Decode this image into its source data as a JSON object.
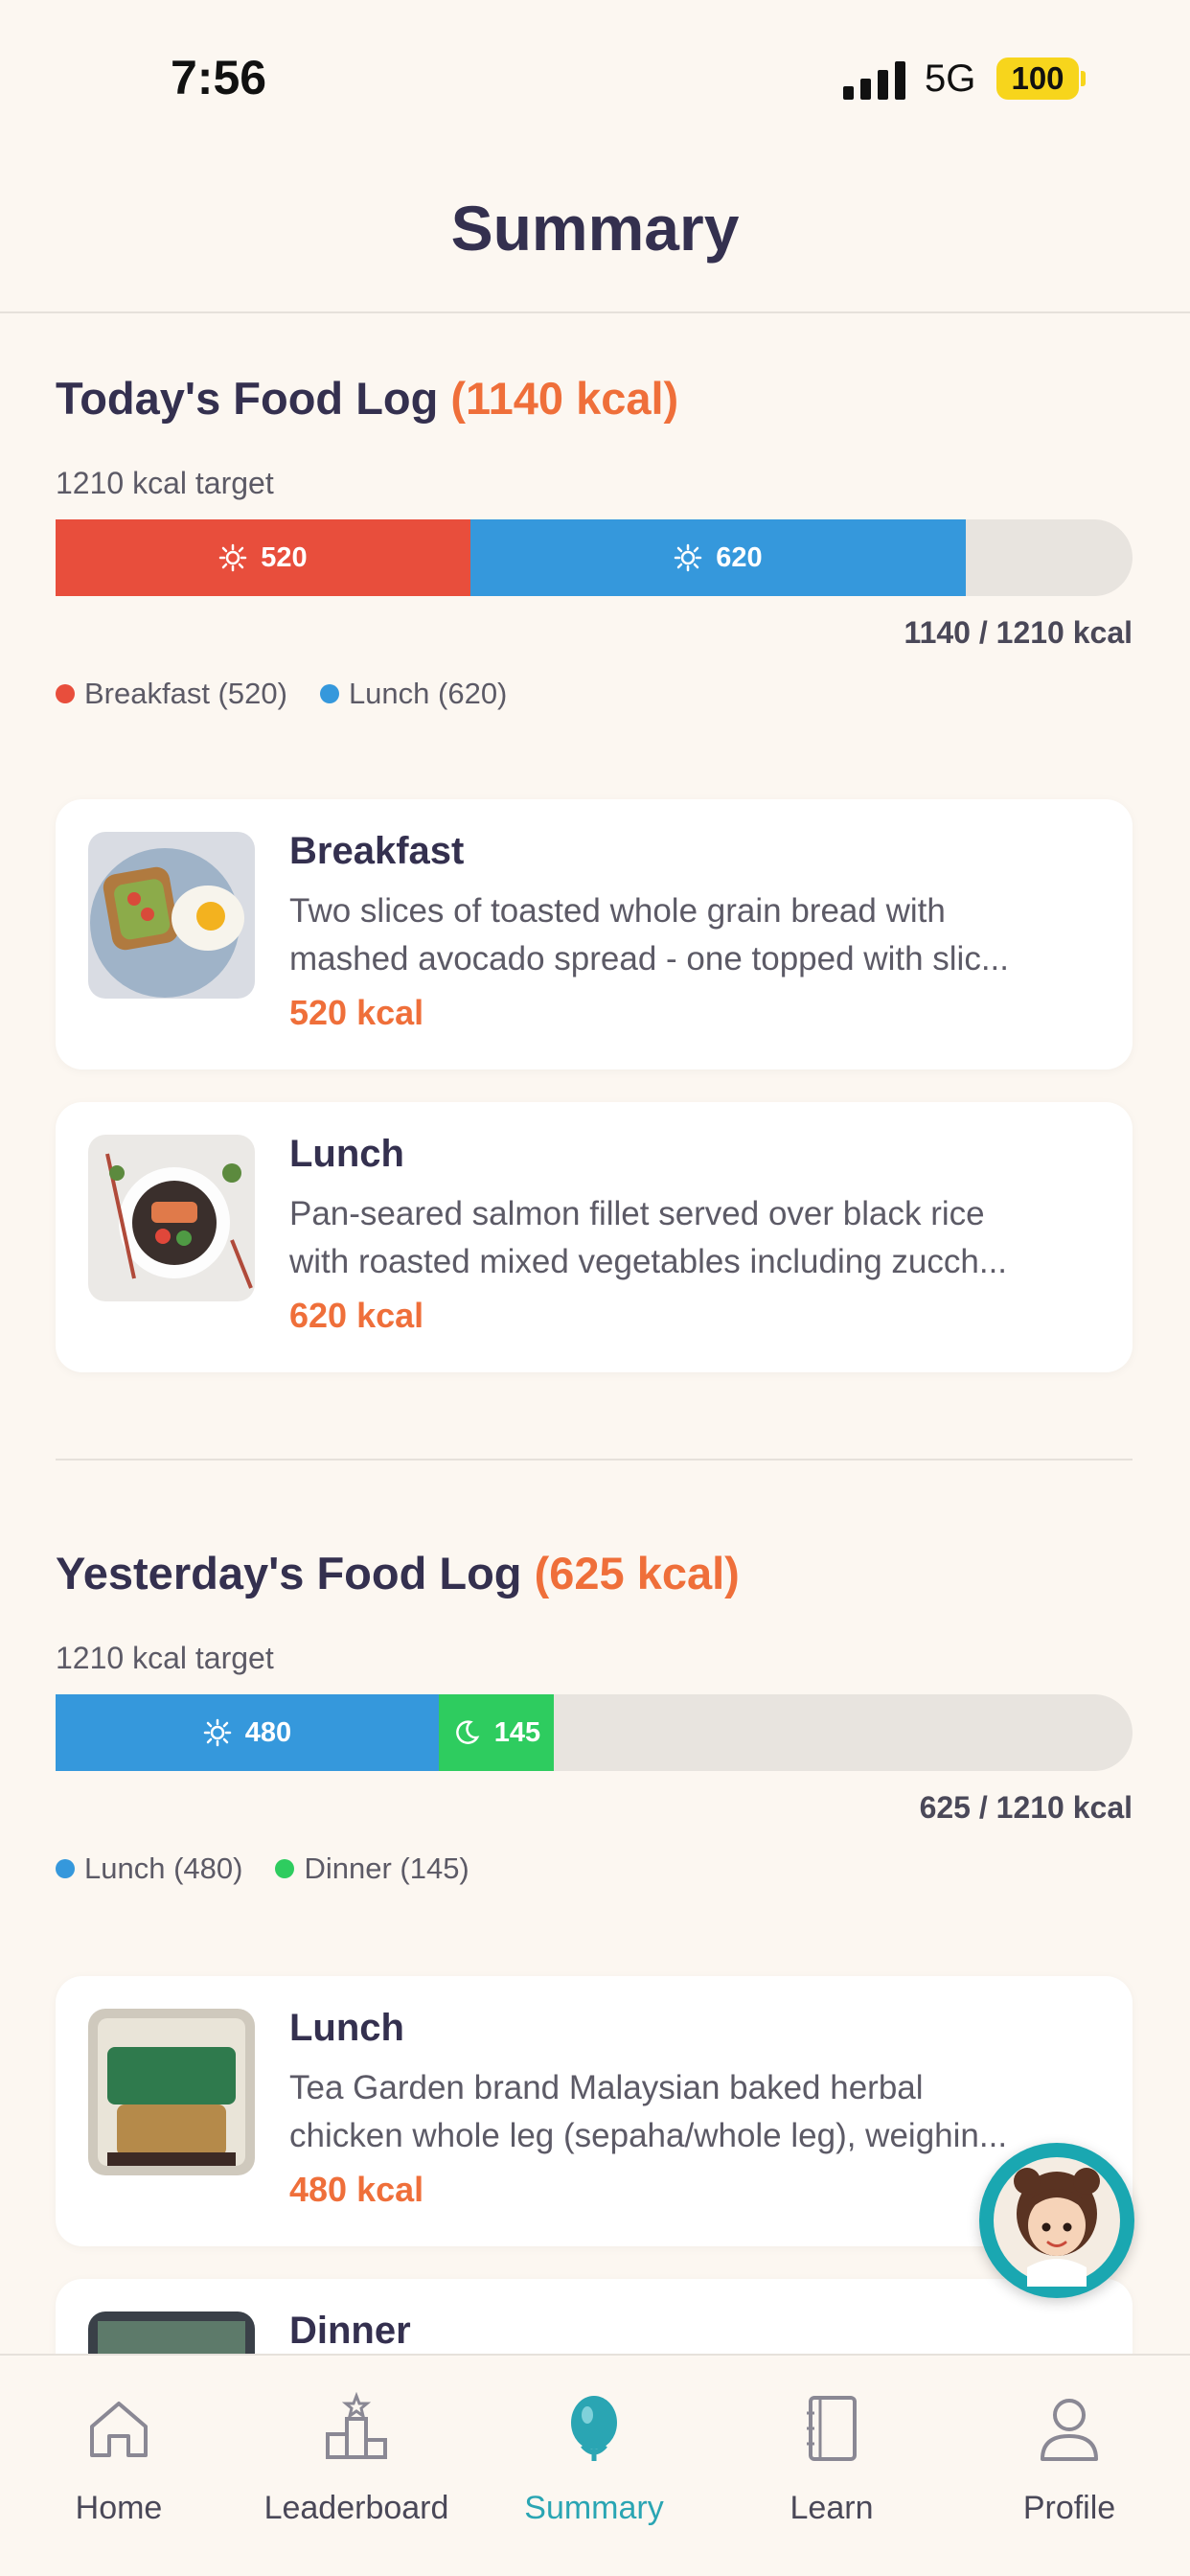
{
  "status": {
    "time": "7:56",
    "network": "5G",
    "battery": "100"
  },
  "header": {
    "title": "Summary"
  },
  "today": {
    "title": "Today's Food Log",
    "total_label": "(1140 kcal)",
    "target_label": "1210 kcal target",
    "progress": {
      "consumed": 1140,
      "target": 1210
    },
    "segments": [
      {
        "meal": "Breakfast",
        "value": "520",
        "kcal": 520,
        "color": "#e84e3c",
        "icon": "sunrise-icon"
      },
      {
        "meal": "Lunch",
        "value": "620",
        "kcal": 620,
        "color": "#3598dc",
        "icon": "sun-icon"
      }
    ],
    "total_text": "1140 / 1210 kcal",
    "legend": [
      {
        "label": "Breakfast (520)",
        "color": "#e84e3c"
      },
      {
        "label": "Lunch (620)",
        "color": "#3598dc"
      }
    ],
    "meals": [
      {
        "name": "Breakfast",
        "desc_line1": "Two slices of toasted whole grain bread with",
        "desc_line2": "mashed avocado spread - one topped with slic...",
        "kcal": "520 kcal"
      },
      {
        "name": "Lunch",
        "desc_line1": "Pan-seared salmon fillet served over black rice",
        "desc_line2": "with roasted mixed vegetables including zucch...",
        "kcal": "620 kcal"
      }
    ]
  },
  "yesterday": {
    "title": "Yesterday's Food Log",
    "total_label": "(625 kcal)",
    "target_label": "1210 kcal target",
    "progress": {
      "consumed": 625,
      "target": 1210
    },
    "segments": [
      {
        "meal": "Lunch",
        "value": "480",
        "kcal": 480,
        "color": "#3598dc",
        "icon": "sun-icon"
      },
      {
        "meal": "Dinner",
        "value": "145",
        "kcal": 145,
        "color": "#2ecc5f",
        "icon": "moon-icon"
      }
    ],
    "total_text": "625 / 1210 kcal",
    "legend": [
      {
        "label": "Lunch (480)",
        "color": "#3598dc"
      },
      {
        "label": "Dinner (145)",
        "color": "#2ecc5f"
      }
    ],
    "meals": [
      {
        "name": "Lunch",
        "desc_line1": "Tea Garden brand Malaysian baked herbal",
        "desc_line2": "chicken whole leg (sepaha/whole leg), weighin...",
        "kcal": "480 kcal"
      },
      {
        "name": "Dinner"
      }
    ]
  },
  "tabs": [
    {
      "label": "Home",
      "icon": "home-icon",
      "active": false
    },
    {
      "label": "Leaderboard",
      "icon": "leaderboard-icon",
      "active": false
    },
    {
      "label": "Summary",
      "icon": "summary-icon",
      "active": true
    },
    {
      "label": "Learn",
      "icon": "book-icon",
      "active": false
    },
    {
      "label": "Profile",
      "icon": "profile-icon",
      "active": false
    }
  ],
  "colors": {
    "accent": "#2aa5b3",
    "kcal": "#ef6f3a",
    "background": "#fcf7f1"
  }
}
